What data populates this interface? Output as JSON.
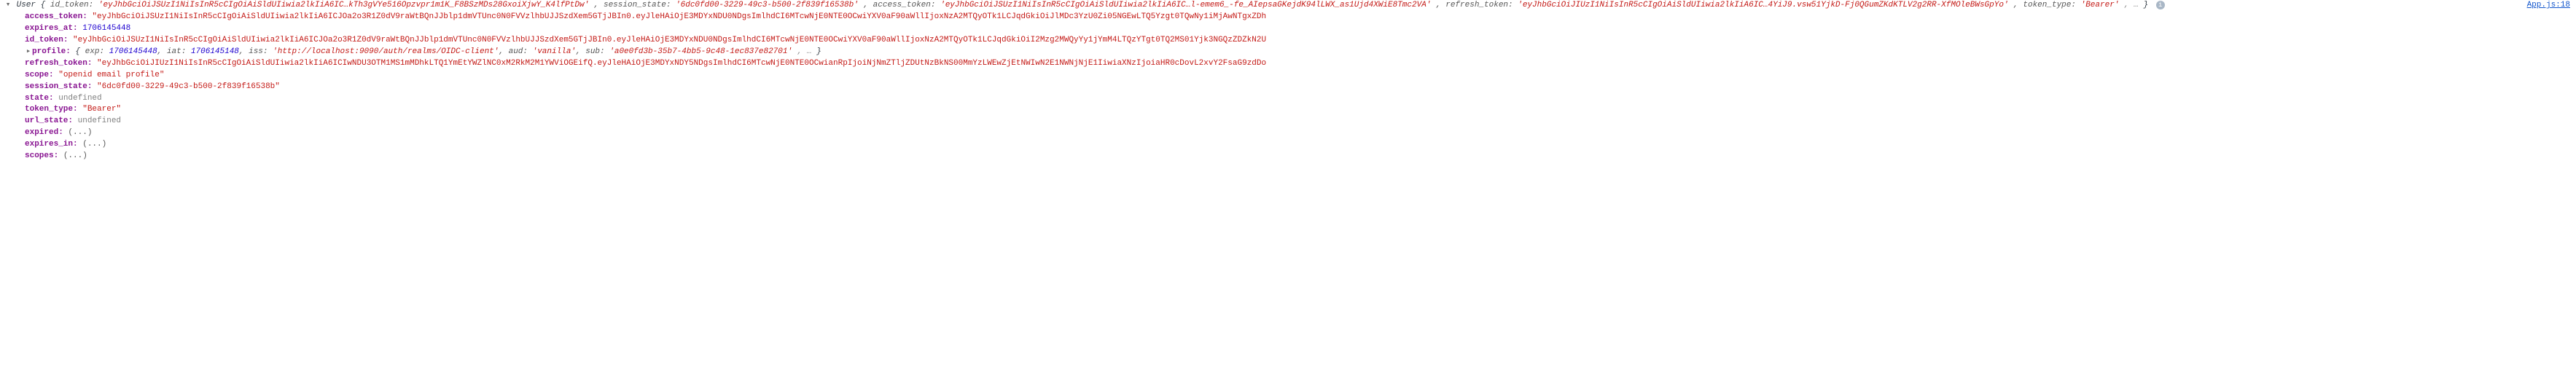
{
  "source_link": "App.js:18",
  "object": {
    "class_name": "User",
    "preview": {
      "id_token": "'eyJhbGciOiJSUzI1NiIsInR5cCIgOiAiSldUIiwia2lkIiA6IC…kTh3gVYe516Opzvpr1m1K_F8BSzMDs28GxoiXjwY_K4lfPtDw'",
      "session_state": "'6dc0fd00-3229-49c3-b500-2f839f16538b'",
      "access_token": "'eyJhbGciOiJSUzI1NiIsInR5cCIgOiAiSldUIiwia2lkIiA6IC…l-emem6_-fe_AIepsaGKejdK94lLWX_as1Ujd4XWiE8Tmc2VA'",
      "refresh_token": "'eyJhbGciOiJIUzI1NiIsInR5cCIgOiAiSldUIiwia2lkIiA6IC…4YiJ9.vsw51YjkD-Fj0QGumZKdKTLV2g2RR-XfMOleBWsGpYo'",
      "token_type": "'Bearer'",
      "trailer": ", …"
    }
  },
  "props": {
    "access_token": "\"eyJhbGciOiJSUzI1NiIsInR5cCIgOiAiSldUIiwia2lkIiA6ICJOa2o3R1Z0dV9raWtBQnJJblp1dmVTUnc0N0FVVzlhbUJJSzdXem5GTjJBIn0.eyJleHAiOjE3MDYxNDU0NDgsImlhdCI6MTcwNjE0NTE0OCwiYXV0aF90aWllIjoxNzA2MTQyOTk1LCJqdGkiOiJlMDc3YzU0Zi05NGEwLTQ5Yzgt0TQwNy1iMjAwNTgxZDh",
    "expires_at": "1706145448",
    "id_token": "\"eyJhbGciOiJSUzI1NiIsInR5cCIgOiAiSldUIiwia2lkIiA6ICJOa2o3R1Z0dV9raWtBQnJJblp1dmVTUnc0N0FVVzlhbUJJSzdXem5GTjJBIn0.eyJleHAiOjE3MDYxNDU0NDgsImlhdCI6MTcwNjE0NTE0OCwiYXV0aF90aWllIjoxNzA2MTQyOTk1LCJqdGkiOiI2Mzg2MWQyYy1jYmM4LTQzYTgt0TQ2MS01Yjk3NGQzZDZkN2U",
    "profile": {
      "exp": "1706145448",
      "iat": "1706145148",
      "iss": "'http://localhost:9090/auth/realms/OIDC-client'",
      "aud": "'vanilla'",
      "sub": "'a0e0fd3b-35b7-4bb5-9c48-1ec837e82701'",
      "trailer": ", …"
    },
    "refresh_token": "\"eyJhbGciOiJIUzI1NiIsInR5cCIgOiAiSldUIiwia2lkIiA6ICIwNDU3OTM1MS1mMDhkLTQ1YmEtYWZlNC0xM2RkM2M1YWViOGEifQ.eyJleHAiOjE3MDYxNDY5NDgsImlhdCI6MTcwNjE0NTE0OCwianRpIjoiNjNmZTljZDUtNzBkNS00MmYzLWEwZjEtNWIwN2E1NWNjNjE1IiwiaXNzIjoiaHR0cDovL2xvY2FsaG9zdDo",
    "scope": "\"openid email profile\"",
    "session_state": "\"6dc0fd00-3229-49c3-b500-2f839f16538b\"",
    "state": "undefined",
    "token_type": "\"Bearer\"",
    "url_state": "undefined",
    "expired_lazy": "(...)",
    "expires_in_lazy": "(...)",
    "scopes_lazy": "(...)"
  },
  "labels": {
    "access_token": "access_token",
    "expires_at": "expires_at",
    "id_token": "id_token",
    "profile": "profile",
    "refresh_token": "refresh_token",
    "scope": "scope",
    "session_state": "session_state",
    "state": "state",
    "token_type": "token_type",
    "url_state": "url_state",
    "expired": "expired",
    "expires_in": "expires_in",
    "scopes": "scopes",
    "exp": "exp",
    "iat": "iat",
    "iss": "iss",
    "aud": "aud",
    "sub": "sub"
  }
}
